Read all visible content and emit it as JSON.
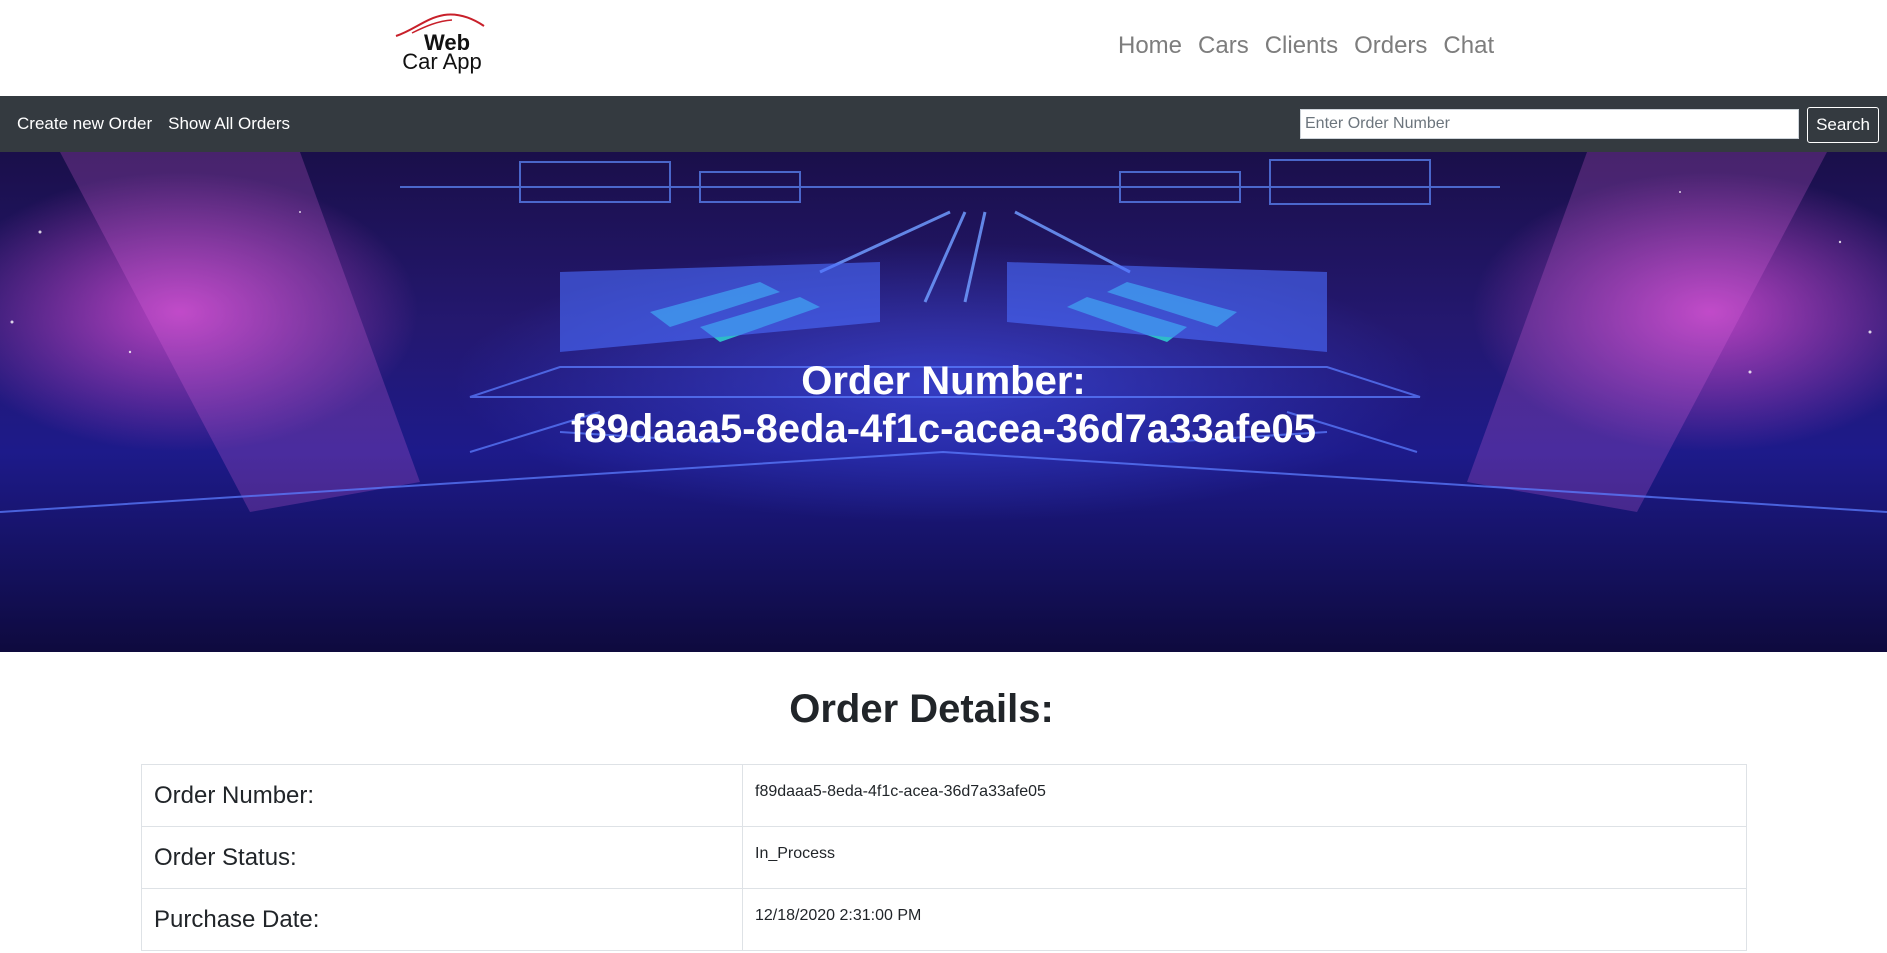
{
  "logo": {
    "line1": "Web",
    "line2": "Car App"
  },
  "nav": {
    "items": [
      "Home",
      "Cars",
      "Clients",
      "Orders",
      "Chat"
    ]
  },
  "subnav": {
    "create_label": "Create new Order",
    "show_all_label": "Show All Orders",
    "search_placeholder": "Enter Order Number",
    "search_label": "Search"
  },
  "hero": {
    "title_line1": "Order Number:",
    "title_line2": "f89daaa5-8eda-4f1c-acea-36d7a33afe05"
  },
  "details": {
    "title": "Order Details:",
    "rows": [
      {
        "label": "Order Number:",
        "value": "f89daaa5-8eda-4f1c-acea-36d7a33afe05"
      },
      {
        "label": "Order Status:",
        "value": "In_Process"
      },
      {
        "label": "Purchase Date:",
        "value": "12/18/2020 2:31:00 PM"
      }
    ]
  },
  "colors": {
    "subnav_bg": "#343a40",
    "nav_link": "#7d7d7d",
    "logo_roof": "#c8202a"
  }
}
